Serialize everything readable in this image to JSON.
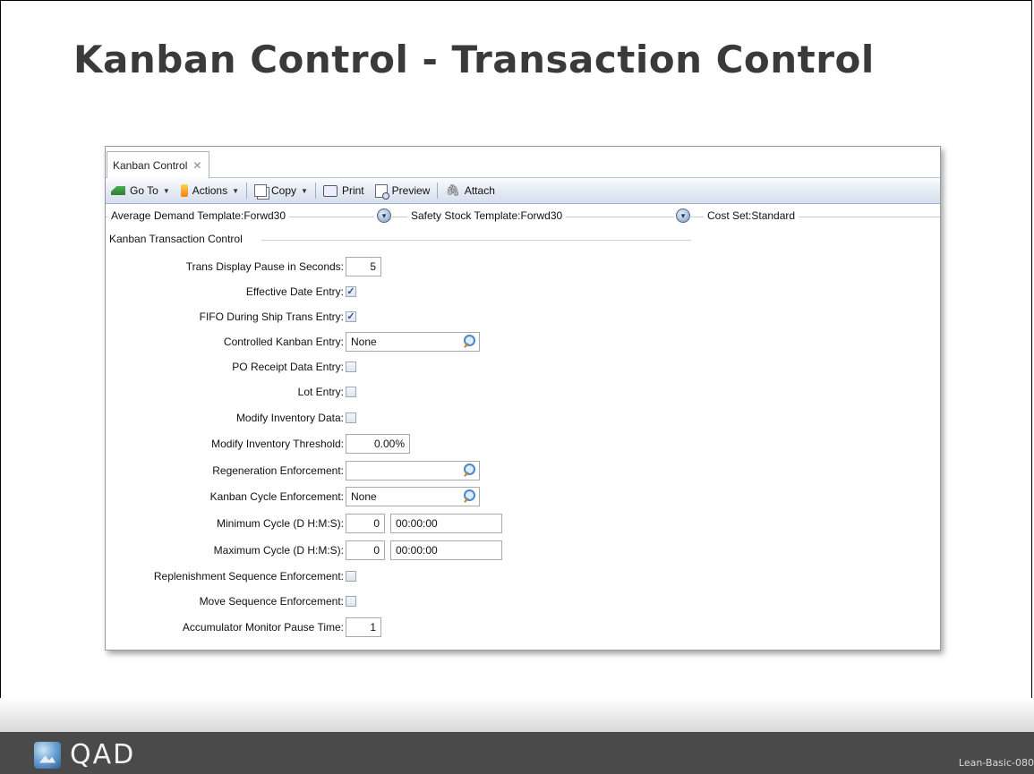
{
  "slide": {
    "title": "Kanban Control - Transaction Control",
    "footer_brand": "QAD",
    "slide_id": "Lean-Basic-080"
  },
  "window": {
    "tab_label": "Kanban Control",
    "toolbar": {
      "goto_label": "Go To",
      "actions_label": "Actions",
      "copy_label": "Copy",
      "print_label": "Print",
      "preview_label": "Preview",
      "attach_label": "Attach"
    },
    "sections": {
      "average_demand": "Average Demand Template:Forwd30",
      "safety_stock": "Safety Stock Template:Forwd30",
      "cost_set": "Cost Set:Standard"
    },
    "group_header": "Kanban Transaction Control",
    "fields": {
      "trans_display_pause_label": "Trans Display Pause in Seconds:",
      "trans_display_pause_value": "5",
      "effective_date_entry_label": "Effective Date Entry:",
      "effective_date_entry_checked": true,
      "fifo_ship_trans_label": "FIFO During Ship Trans Entry:",
      "fifo_ship_trans_checked": true,
      "controlled_kanban_entry_label": "Controlled Kanban Entry:",
      "controlled_kanban_entry_value": "None",
      "po_receipt_data_entry_label": "PO Receipt Data Entry:",
      "po_receipt_data_entry_checked": false,
      "lot_entry_label": "Lot Entry:",
      "lot_entry_checked": false,
      "modify_inventory_data_label": "Modify Inventory Data:",
      "modify_inventory_data_checked": false,
      "modify_inventory_threshold_label": "Modify Inventory Threshold:",
      "modify_inventory_threshold_value": "0.00%",
      "regeneration_enforcement_label": "Regeneration Enforcement:",
      "regeneration_enforcement_value": "",
      "kanban_cycle_enforcement_label": "Kanban Cycle Enforcement:",
      "kanban_cycle_enforcement_value": "None",
      "minimum_cycle_label": "Minimum Cycle (D H:M:S):",
      "minimum_cycle_days": "0",
      "minimum_cycle_time": "00:00:00",
      "maximum_cycle_label": "Maximum Cycle (D H:M:S):",
      "maximum_cycle_days": "0",
      "maximum_cycle_time": "00:00:00",
      "replenishment_sequence_label": "Replenishment Sequence Enforcement:",
      "replenishment_sequence_checked": false,
      "move_sequence_label": "Move Sequence Enforcement:",
      "move_sequence_checked": false,
      "accumulator_pause_label": "Accumulator Monitor Pause Time:",
      "accumulator_pause_value": "1"
    },
    "check_glyph": "✓"
  }
}
